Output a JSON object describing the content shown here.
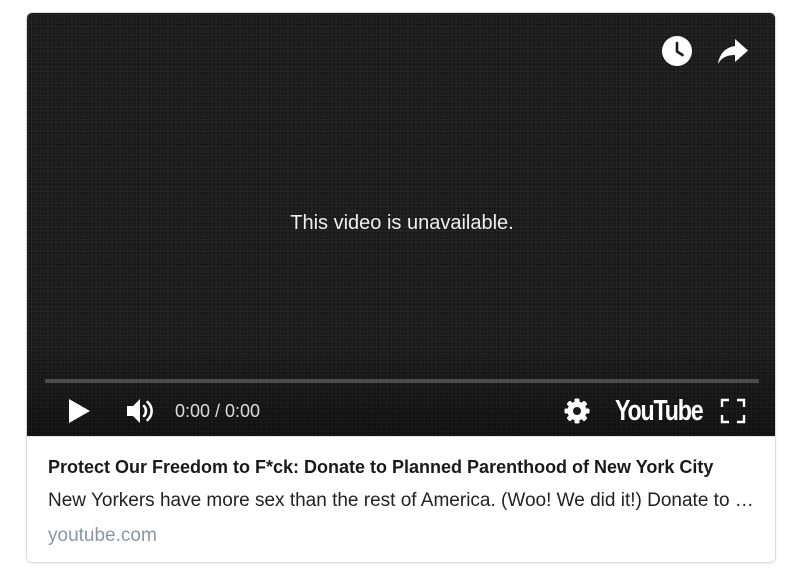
{
  "player": {
    "message": "This video is unavailable.",
    "time_display": "0:00 / 0:00",
    "logo_text": "YouTube",
    "progress_fraction": 0,
    "icons": {
      "watch_later": "clock-icon",
      "share": "share-arrow-icon",
      "play": "play-icon",
      "volume": "volume-icon",
      "settings": "gear-icon",
      "fullscreen": "fullscreen-icon"
    }
  },
  "link_preview": {
    "title": "Protect Our Freedom to F*ck: Donate to Planned Parenthood of New York City",
    "description": "New Yorkers have more sex than the rest of America. (Woo! We did it!) Donate to Planned Parenthood of New York City",
    "domain": "youtube.com"
  },
  "colors": {
    "player_background": "#1b1b1b",
    "domain_text": "#8a96a3"
  }
}
